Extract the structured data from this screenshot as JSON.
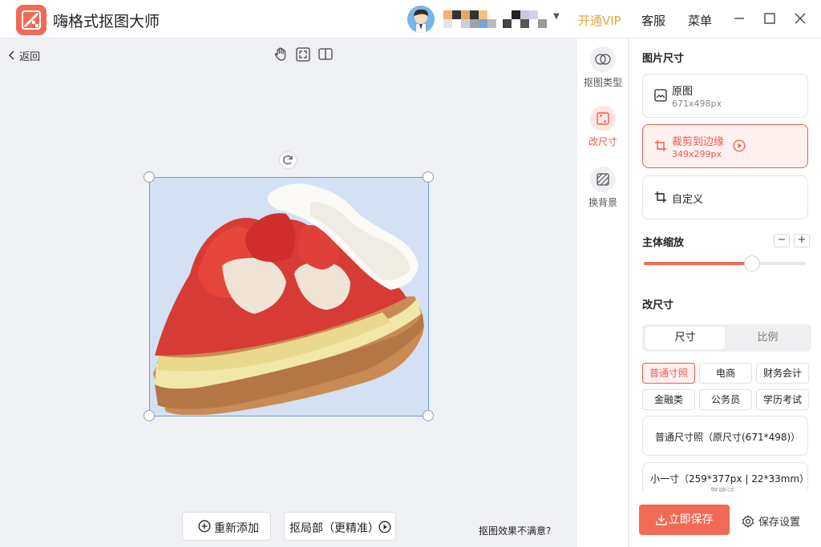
{
  "app": {
    "title": "嗨格式抠图大师"
  },
  "header": {
    "vip_label": "开通VIP",
    "service_label": "客服",
    "menu_label": "菜单"
  },
  "canvas": {
    "back_label": "返回",
    "readd_label": "重新添加",
    "local_label": "抠局部（更精准）",
    "unsatisfied_label": "抠图效果不满意?"
  },
  "tools": [
    {
      "label": "抠图类型",
      "icon": "cutout-type-icon"
    },
    {
      "label": "改尺寸",
      "icon": "resize-icon"
    },
    {
      "label": "换背景",
      "icon": "background-icon"
    }
  ],
  "panel": {
    "image_size_title": "图片尺寸",
    "cards": [
      {
        "name": "原图",
        "dims": "671x498px",
        "icon": "image-icon"
      },
      {
        "name": "裁剪到边缘",
        "dims": "349x299px",
        "icon": "crop-icon"
      },
      {
        "name": "自定义",
        "icon": "crop-icon"
      }
    ],
    "zoom_title": "主体缩放",
    "zoom_minus": "−",
    "zoom_plus": "+",
    "zoom_level": 0.67,
    "resize_title": "改尺寸",
    "tabs": [
      "尺寸",
      "比例"
    ],
    "categories": [
      "普通寸照",
      "电商",
      "财务会计",
      "金融类",
      "公务员",
      "学历考试"
    ],
    "presets": [
      {
        "label": "普通尺寸照（原尺寸(671*498)）"
      },
      {
        "label": "小一寸（259*377px | 22*33mm）",
        "sub": "驾驶证"
      }
    ],
    "save_label": "立即保存",
    "settings_label": "保存设置"
  },
  "colors": {
    "accent": "#f26a55",
    "vip": "#e9a73a",
    "selection": "#6a9ae3",
    "image_bg": "#d3e1f3"
  }
}
